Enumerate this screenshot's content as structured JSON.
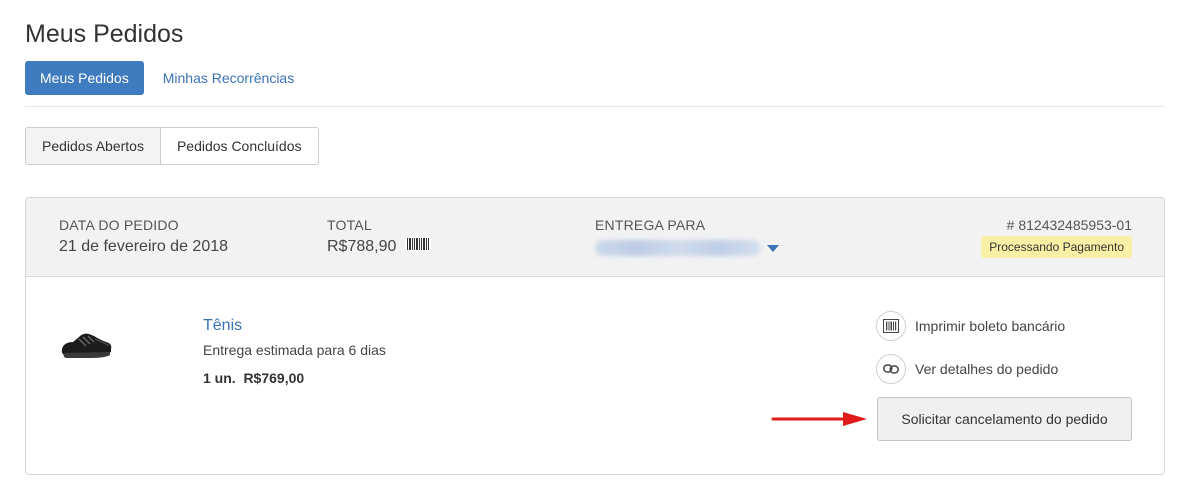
{
  "page": {
    "title": "Meus Pedidos"
  },
  "top_tabs": {
    "active": "Meus Pedidos",
    "secondary": "Minhas Recorrências"
  },
  "filter_tabs": {
    "open": "Pedidos Abertos",
    "done": "Pedidos Concluídos"
  },
  "order": {
    "date_label": "DATA DO PEDIDO",
    "date_value": "21 de fevereiro de 2018",
    "total_label": "TOTAL",
    "total_value": "R$788,90",
    "ship_label": "ENTREGA PARA",
    "order_number": "# 812432485953-01",
    "status": "Processando Pagamento",
    "status_color": "#f9f0a5"
  },
  "item": {
    "name": "Tênis",
    "delivery": "Entrega estimada para 6 dias",
    "qty_price": "1 un.  R$769,00"
  },
  "actions": {
    "print_boleto": "Imprimir boleto bancário",
    "details": "Ver detalhes do pedido",
    "cancel": "Solicitar cancelamento do pedido"
  },
  "colors": {
    "primary": "#3f7bbf",
    "link": "#3a73b6",
    "arrow": "#e01b1b"
  },
  "icons": [
    "barcode-icon",
    "chevron-down-icon",
    "link-icon",
    "arrow-right-icon",
    "shoe-image"
  ]
}
